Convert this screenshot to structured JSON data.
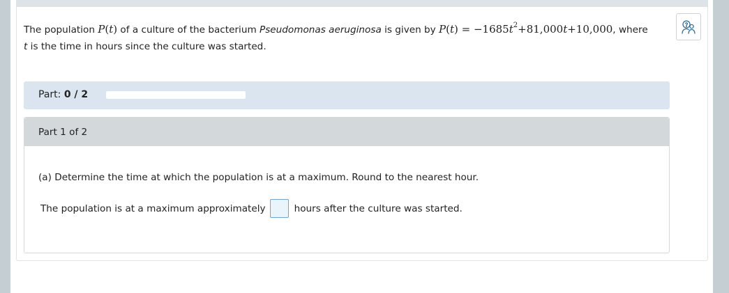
{
  "problem": {
    "text_1": "The population ",
    "fn_name": "P",
    "fn_arg": "t",
    "text_2": " of a culture of the bacterium ",
    "species": "Pseudomonas aeruginosa",
    "text_3": " is given by ",
    "eq_lhs_name": "P",
    "eq_lhs_arg": "t",
    "eq_rhs_a": " = −1685",
    "eq_var_1": "t",
    "eq_exp": "2",
    "eq_rhs_b": "+81,000",
    "eq_var_2": "t",
    "eq_rhs_c": "+10,000",
    "text_4": ", where",
    "text_var_t": "t",
    "text_5": " is the time in hours since the culture was started."
  },
  "tools_button": {
    "icon": "tools-icon"
  },
  "part_progress": {
    "label": "Part:",
    "value": "0 / 2",
    "completed": 0,
    "total": 2,
    "fill_color": "#4a8fc7"
  },
  "part_section": {
    "header": "Part 1 of 2",
    "question": "(a) Determine the time at which the population is at a maximum. Round to the nearest hour.",
    "answer_prefix": "The population is at a maximum approximately",
    "answer_value": "",
    "answer_suffix": "hours after the culture was started."
  }
}
